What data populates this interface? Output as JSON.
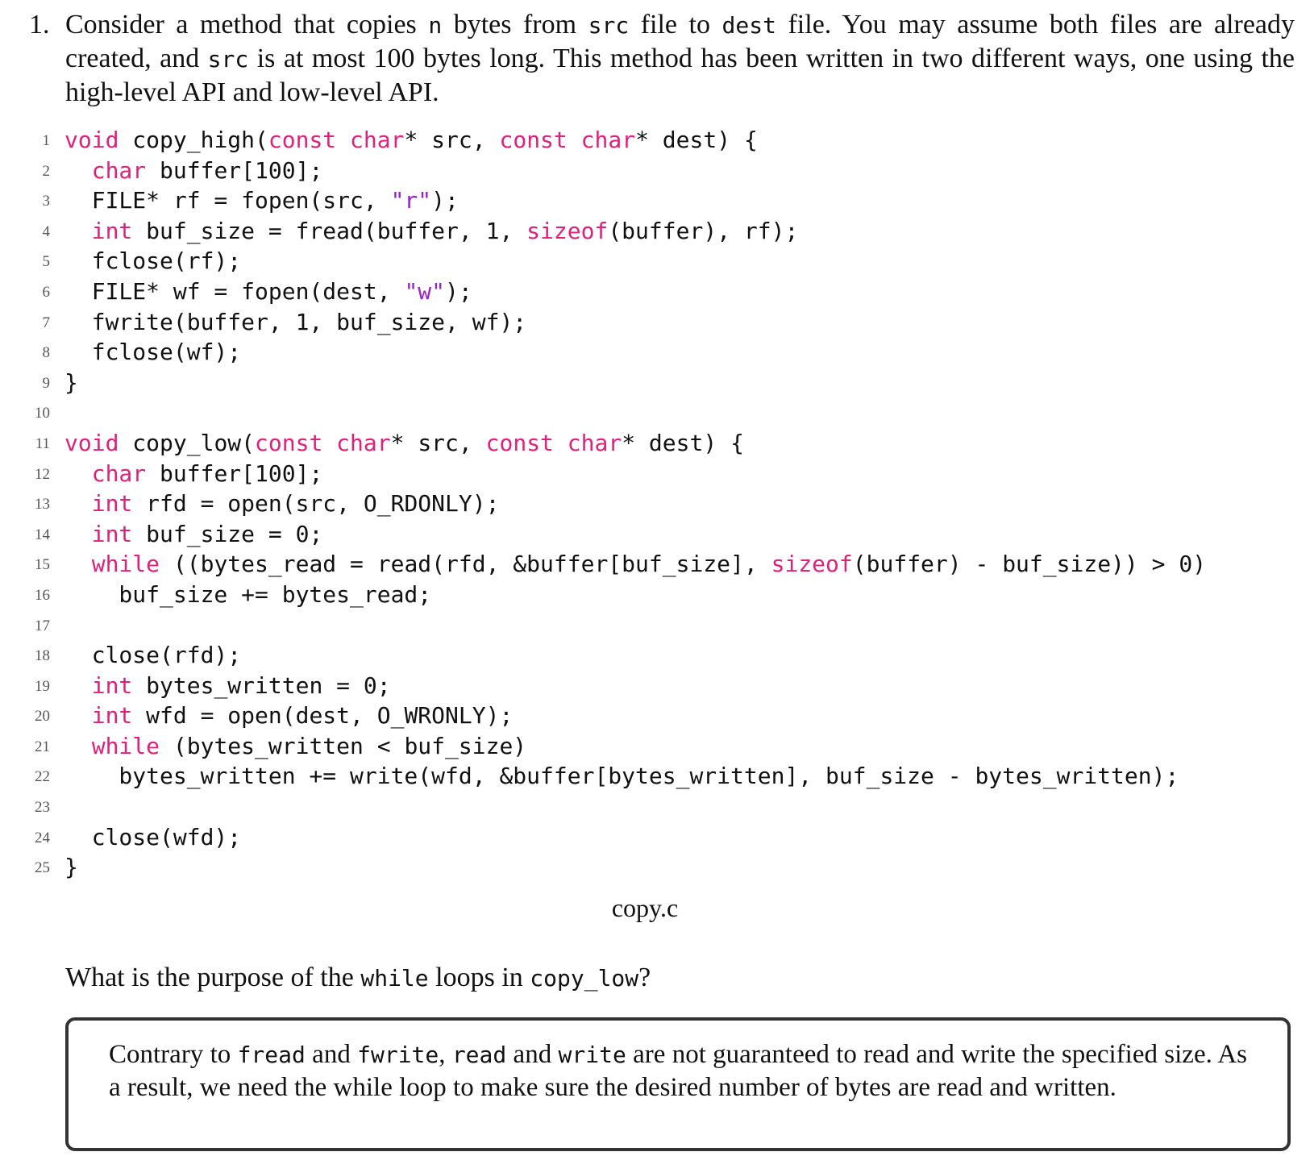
{
  "question": {
    "number": "1.",
    "segments": [
      {
        "t": "Consider a method that copies ",
        "mono": false
      },
      {
        "t": "n",
        "mono": true
      },
      {
        "t": " bytes from ",
        "mono": false
      },
      {
        "t": "src",
        "mono": true
      },
      {
        "t": " file to ",
        "mono": false
      },
      {
        "t": "dest",
        "mono": true
      },
      {
        "t": " file. You may assume both files are already created, and ",
        "mono": false
      },
      {
        "t": "src",
        "mono": true
      },
      {
        "t": " is at most 100 bytes long. This method has been written in two different ways, one using the high-level API and low-level API.",
        "mono": false
      }
    ]
  },
  "code": {
    "lines": [
      {
        "n": "1",
        "tokens": [
          [
            "kw",
            "void"
          ],
          [
            "p",
            " copy_high("
          ],
          [
            "kw",
            "const"
          ],
          [
            "p",
            " "
          ],
          [
            "kw",
            "char"
          ],
          [
            "p",
            "* src, "
          ],
          [
            "kw",
            "const"
          ],
          [
            "p",
            " "
          ],
          [
            "kw",
            "char"
          ],
          [
            "p",
            "* dest) {"
          ]
        ]
      },
      {
        "n": "2",
        "tokens": [
          [
            "p",
            "  "
          ],
          [
            "kw",
            "char"
          ],
          [
            "p",
            " buffer[100];"
          ]
        ]
      },
      {
        "n": "3",
        "tokens": [
          [
            "p",
            "  FILE* rf = fopen(src, "
          ],
          [
            "str",
            "\"r\""
          ],
          [
            "p",
            ");"
          ]
        ]
      },
      {
        "n": "4",
        "tokens": [
          [
            "p",
            "  "
          ],
          [
            "kw",
            "int"
          ],
          [
            "p",
            " buf_size = fread(buffer, 1, "
          ],
          [
            "kw",
            "sizeof"
          ],
          [
            "p",
            "(buffer), rf);"
          ]
        ]
      },
      {
        "n": "5",
        "tokens": [
          [
            "p",
            "  fclose(rf);"
          ]
        ]
      },
      {
        "n": "6",
        "tokens": [
          [
            "p",
            "  FILE* wf = fopen(dest, "
          ],
          [
            "str",
            "\"w\""
          ],
          [
            "p",
            ");"
          ]
        ]
      },
      {
        "n": "7",
        "tokens": [
          [
            "p",
            "  fwrite(buffer, 1, buf_size, wf);"
          ]
        ]
      },
      {
        "n": "8",
        "tokens": [
          [
            "p",
            "  fclose(wf);"
          ]
        ]
      },
      {
        "n": "9",
        "tokens": [
          [
            "p",
            "}"
          ]
        ]
      },
      {
        "n": "10",
        "tokens": []
      },
      {
        "n": "11",
        "tokens": [
          [
            "kw",
            "void"
          ],
          [
            "p",
            " copy_low("
          ],
          [
            "kw",
            "const"
          ],
          [
            "p",
            " "
          ],
          [
            "kw",
            "char"
          ],
          [
            "p",
            "* src, "
          ],
          [
            "kw",
            "const"
          ],
          [
            "p",
            " "
          ],
          [
            "kw",
            "char"
          ],
          [
            "p",
            "* dest) {"
          ]
        ]
      },
      {
        "n": "12",
        "tokens": [
          [
            "p",
            "  "
          ],
          [
            "kw",
            "char"
          ],
          [
            "p",
            " buffer[100];"
          ]
        ]
      },
      {
        "n": "13",
        "tokens": [
          [
            "p",
            "  "
          ],
          [
            "kw",
            "int"
          ],
          [
            "p",
            " rfd = open(src, O_RDONLY);"
          ]
        ]
      },
      {
        "n": "14",
        "tokens": [
          [
            "p",
            "  "
          ],
          [
            "kw",
            "int"
          ],
          [
            "p",
            " buf_size = 0;"
          ]
        ]
      },
      {
        "n": "15",
        "tokens": [
          [
            "p",
            "  "
          ],
          [
            "kw",
            "while"
          ],
          [
            "p",
            " ((bytes_read = read(rfd, &buffer[buf_size], "
          ],
          [
            "kw",
            "sizeof"
          ],
          [
            "p",
            "(buffer) - buf_size)) > 0)"
          ]
        ]
      },
      {
        "n": "16",
        "tokens": [
          [
            "p",
            "    buf_size += bytes_read;"
          ]
        ]
      },
      {
        "n": "17",
        "tokens": []
      },
      {
        "n": "18",
        "tokens": [
          [
            "p",
            "  close(rfd);"
          ]
        ]
      },
      {
        "n": "19",
        "tokens": [
          [
            "p",
            "  "
          ],
          [
            "kw",
            "int"
          ],
          [
            "p",
            " bytes_written = 0;"
          ]
        ]
      },
      {
        "n": "20",
        "tokens": [
          [
            "p",
            "  "
          ],
          [
            "kw",
            "int"
          ],
          [
            "p",
            " wfd = open(dest, O_WRONLY);"
          ]
        ]
      },
      {
        "n": "21",
        "tokens": [
          [
            "p",
            "  "
          ],
          [
            "kw",
            "while"
          ],
          [
            "p",
            " (bytes_written < buf_size)"
          ]
        ]
      },
      {
        "n": "22",
        "tokens": [
          [
            "p",
            "    bytes_written += write(wfd, &buffer[bytes_written], buf_size - bytes_written);"
          ]
        ]
      },
      {
        "n": "23",
        "tokens": []
      },
      {
        "n": "24",
        "tokens": [
          [
            "p",
            "  close(wfd);"
          ]
        ]
      },
      {
        "n": "25",
        "tokens": [
          [
            "p",
            "}"
          ]
        ]
      }
    ],
    "caption": "copy.c"
  },
  "prompt": {
    "segments": [
      {
        "t": "What is the purpose of the ",
        "mono": false
      },
      {
        "t": "while",
        "mono": true
      },
      {
        "t": " loops in ",
        "mono": false
      },
      {
        "t": "copy_low",
        "mono": true
      },
      {
        "t": "?",
        "mono": false
      }
    ]
  },
  "answer": {
    "segments": [
      {
        "t": "Contrary to ",
        "mono": false
      },
      {
        "t": "fread",
        "mono": true
      },
      {
        "t": " and ",
        "mono": false
      },
      {
        "t": "fwrite",
        "mono": true
      },
      {
        "t": ", ",
        "mono": false
      },
      {
        "t": "read",
        "mono": true
      },
      {
        "t": " and ",
        "mono": false
      },
      {
        "t": "write",
        "mono": true
      },
      {
        "t": " are not guaranteed to read and write the specified size. As a result, we need the while loop to make sure the desired number of bytes are read and written.",
        "mono": false
      }
    ]
  },
  "colors": {
    "keyword": "#e0207a",
    "string": "#9a1fc9",
    "text": "#111111",
    "line_number": "#555555",
    "box_border": "#333333"
  }
}
